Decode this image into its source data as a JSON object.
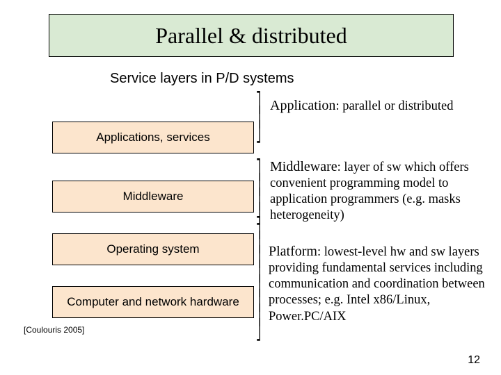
{
  "title": "Parallel & distributed",
  "subtitle": "Service layers in P/D systems",
  "layers": {
    "applications": "Applications, services",
    "middleware": "Middleware",
    "os": "Operating system",
    "hardware": "Computer and network hardware"
  },
  "descriptions": {
    "application_lead": "Application",
    "application_rest": ": parallel or distributed",
    "middleware_lead": "Middleware",
    "middleware_rest": ": layer of sw which offers convenient programming model to application programmers (e.g. masks heterogeneity)",
    "platform_lead": "Platform",
    "platform_rest": ": lowest-level hw and sw layers providing fundamental services including communication and coordination between processes; e.g. Intel x86/Linux, Power.PC/AIX"
  },
  "citation": "[Coulouris 2005]",
  "page_number": "12"
}
